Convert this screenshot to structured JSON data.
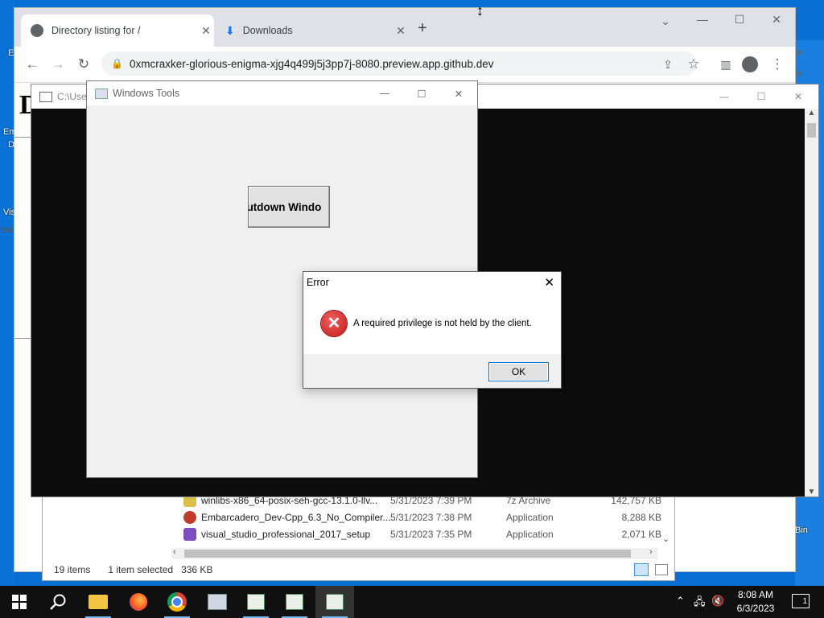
{
  "desktop": {
    "left_labels": [
      "E",
      "Em",
      "D",
      "Vis",
      "Sel"
    ],
    "right_label": "Bin"
  },
  "browser": {
    "tabs": [
      {
        "title": "Directory listing for /",
        "icon": "globe-icon"
      },
      {
        "title": "Downloads",
        "icon": "download-icon"
      }
    ],
    "new_tab": "+",
    "url": "0xmcraxker-glorious-enigma-xjg4q499j5j3pp7j-8080.preview.app.github.dev",
    "page_partial_text": "D"
  },
  "console": {
    "title": "C:\\User"
  },
  "windows_tools": {
    "title": "Windows Tools",
    "shutdown_button": "utdown Windo"
  },
  "error_dialog": {
    "title": "Error",
    "message": "A required privilege is not held by the client.",
    "ok": "OK"
  },
  "explorer": {
    "files": [
      {
        "name": "winlibs-x86_64-posix-seh-gcc-13.1.0-llv...",
        "date": "5/31/2023 7:39 PM",
        "type": "7z Archive",
        "size": "142,757 KB",
        "color": "#d8c04a"
      },
      {
        "name": "Embarcadero_Dev-Cpp_6.3_No_Compiler...",
        "date": "5/31/2023 7:38 PM",
        "type": "Application",
        "size": "8,288 KB",
        "color": "#c0392b"
      },
      {
        "name": "visual_studio_professional_2017_setup",
        "date": "5/31/2023 7:35 PM",
        "type": "Application",
        "size": "2,071 KB",
        "color": "#7b4fbf"
      }
    ],
    "status_items": "19 items",
    "status_selected": "1 item selected",
    "status_size": "336 KB"
  },
  "taskbar": {
    "time": "8:08 AM",
    "date": "6/3/2023",
    "notification_count": "1"
  }
}
